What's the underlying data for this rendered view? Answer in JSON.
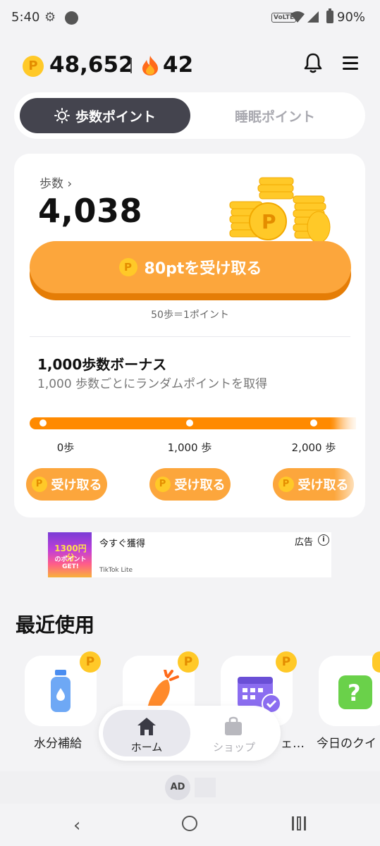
{
  "status_bar": {
    "time": "5:40",
    "network": "VoLTE",
    "battery": "90%"
  },
  "header": {
    "points": "48,652",
    "streak": "42",
    "coin_symbol": "P"
  },
  "tabs": [
    {
      "label": "歩数ポイント",
      "active": true
    },
    {
      "label": "睡眠ポイント",
      "active": false
    }
  ],
  "steps": {
    "label": "歩数 ›",
    "value": "4,038",
    "claim_label": "80ptを受け取る",
    "rate": "50歩＝1ポイント"
  },
  "bonus": {
    "title": "1,000歩数ボーナス",
    "subtitle": "1,000 歩数ごとにランダムポイントを取得",
    "milestones": [
      {
        "label": "0歩",
        "button": "受け取る"
      },
      {
        "label": "1,000 歩",
        "button": "受け取る"
      },
      {
        "label": "2,000 歩",
        "button": "受け取る"
      }
    ]
  },
  "ad_banner": {
    "title": "今すぐ獲得",
    "brand": "TikTok Lite",
    "ad_label": "広告",
    "thumb_text": "1300円分",
    "thumb_sub": "のポイントGET!"
  },
  "recent": {
    "title": "最近使用",
    "items": [
      {
        "label": "水分補給",
        "icon": "water-bottle-icon"
      },
      {
        "label": "",
        "icon": "carrot-icon"
      },
      {
        "label": "ェ…",
        "icon": "calendar-check-icon"
      },
      {
        "label": "今日のクイ",
        "icon": "quiz-icon"
      }
    ]
  },
  "bottom_nav": {
    "home_label": "ホーム",
    "shop_label": "ショップ"
  },
  "ad_strip": {
    "badge": "AD"
  },
  "colors": {
    "accent": "#fca63c",
    "accent_dark": "#e57d06",
    "track": "#ff8a00",
    "tab_active": "#44444e",
    "coin": "#ffc928"
  }
}
